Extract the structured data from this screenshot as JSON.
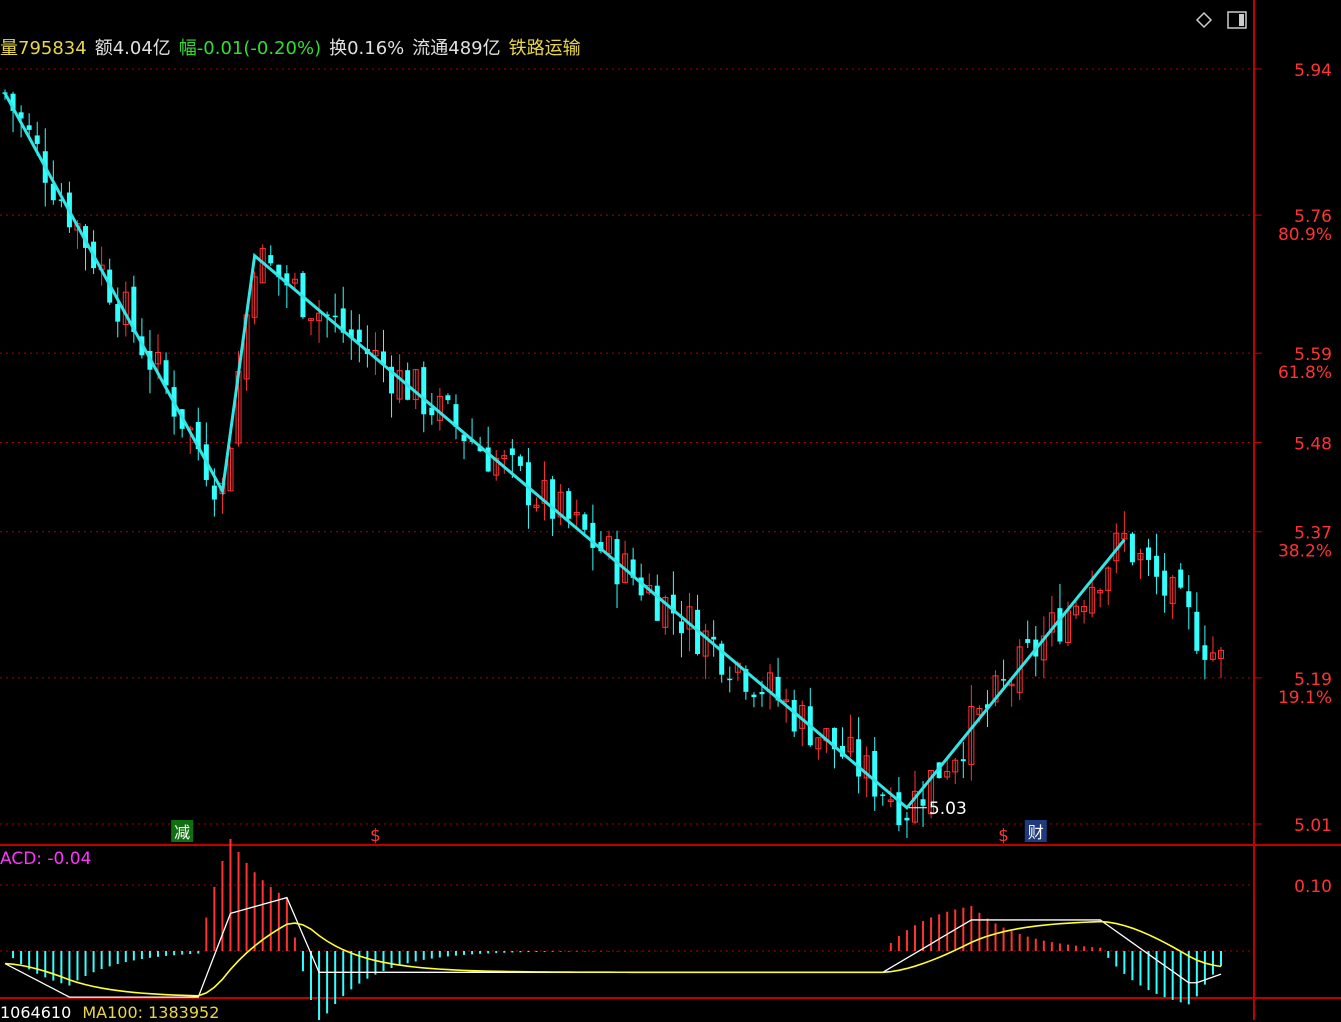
{
  "header": {
    "volume": "量795834",
    "amount": "额4.04亿",
    "change": "幅-0.01(-0.20%)",
    "turnover": "换0.16%",
    "float_cap": "流通489亿",
    "sector": "铁路运输"
  },
  "colors": {
    "up": "#ff3333",
    "down": "#33ffff",
    "zigzag": "#33e6e6",
    "axis": "#c00000",
    "dif": "#ffffff",
    "dea": "#ffff33",
    "grid": "#b00000"
  },
  "chart_data": {
    "type": "candlestick",
    "y_axis": {
      "ticks": [
        {
          "value": 5.94,
          "label": "5.94",
          "fib": ""
        },
        {
          "value": 5.76,
          "label": "5.76",
          "fib": "80.9%"
        },
        {
          "value": 5.59,
          "label": "5.59",
          "fib": "61.8%"
        },
        {
          "value": 5.48,
          "label": "5.48",
          "fib": ""
        },
        {
          "value": 5.37,
          "label": "5.37",
          "fib": "38.2%"
        },
        {
          "value": 5.19,
          "label": "5.19",
          "fib": "19.1%"
        },
        {
          "value": 5.01,
          "label": "5.01",
          "fib": ""
        }
      ],
      "range": [
        5.01,
        5.94
      ]
    },
    "zigzag": [
      {
        "bar": 0,
        "price": 5.91
      },
      {
        "bar": 27,
        "price": 5.42
      },
      {
        "bar": 31,
        "price": 5.71
      },
      {
        "bar": 112,
        "price": 5.03
      },
      {
        "bar": 139,
        "price": 5.36
      }
    ],
    "low_marker": {
      "label": "5.03",
      "bar": 112,
      "price": 5.03
    },
    "events": [
      {
        "bar": 22,
        "label": "减",
        "kind": "reduce"
      },
      {
        "bar": 46,
        "label": "$",
        "kind": "dividend"
      },
      {
        "bar": 124,
        "label": "$",
        "kind": "dividend"
      },
      {
        "bar": 128,
        "label": "财",
        "kind": "report"
      }
    ],
    "macd": {
      "label": "ACD: -0.04",
      "ticks": [
        {
          "value": 0.1,
          "label": "0.10"
        }
      ],
      "range": [
        -0.06,
        0.12
      ]
    },
    "volume_label": "1064610",
    "ma100_label": "MA100: 1383952"
  }
}
